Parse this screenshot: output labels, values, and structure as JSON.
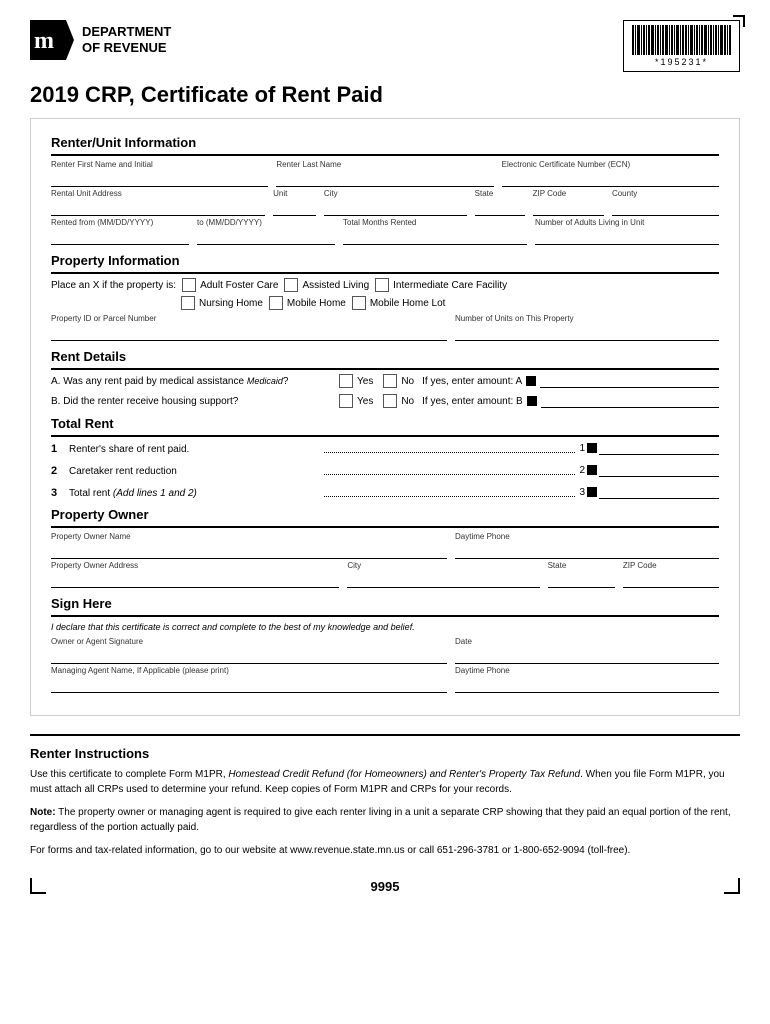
{
  "header": {
    "logo_dept_line1": "DEPARTMENT",
    "logo_dept_line2": "OF REVENUE",
    "form_title": "2019 CRP, Certificate of Rent Paid",
    "barcode_number": "*195231*"
  },
  "renter_info": {
    "section_title": "Renter/Unit Information",
    "field_first_name": "Renter First Name and Initial",
    "field_last_name": "Renter Last Name",
    "field_ecn": "Electronic Certificate Number (ECN)",
    "field_rental_address": "Rental Unit Address",
    "field_unit": "Unit",
    "field_city": "City",
    "field_state": "State",
    "field_zip": "ZIP Code",
    "field_county": "County",
    "field_rented_from": "Rented from (MM/DD/YYYY)",
    "field_rented_to": "to (MM/DD/YYYY)",
    "field_total_months": "Total Months Rented",
    "field_adults": "Number of Adults Living in Unit"
  },
  "property_info": {
    "section_title": "Property Information",
    "place_x_label": "Place an X if the property is:",
    "checkbox1": "Adult Foster Care",
    "checkbox2": "Assisted Living",
    "checkbox3": "Intermediate Care Facility",
    "checkbox4": "Nursing Home",
    "checkbox5": "Mobile Home",
    "checkbox6": "Mobile Home Lot",
    "field_property_id": "Property ID or Parcel Number",
    "field_num_units": "Number of Units on This Property"
  },
  "rent_details": {
    "section_title": "Rent Details",
    "row_a_label": "A. Was any rent paid by medical assistance (Medicaid)?",
    "row_a_medicaid": "Medicaid",
    "row_b_label": "B. Did the renter receive housing support?",
    "yes_label": "Yes",
    "no_label": "No",
    "if_yes_label_a": "If yes, enter amount:  A",
    "if_yes_label_b": "If yes, enter amount:  B"
  },
  "total_rent": {
    "section_title": "Total Rent",
    "row1_num": "1",
    "row1_label": "Renter's share of rent paid.",
    "row1_num_label": "1",
    "row2_num": "2",
    "row2_label": "Caretaker rent reduction",
    "row2_num_label": "2",
    "row3_num": "3",
    "row3_label": "Total rent (Add lines 1 and 2)",
    "row3_num_label": "3"
  },
  "property_owner": {
    "section_title": "Property Owner",
    "field_owner_name": "Property Owner Name",
    "field_daytime_phone": "Daytime Phone",
    "field_owner_address": "Property Owner Address",
    "field_city": "City",
    "field_state": "State",
    "field_zip": "ZIP Code"
  },
  "sign_here": {
    "section_title": "Sign Here",
    "declaration_text": "I declare that this certificate is correct and complete to the best of my knowledge and belief.",
    "field_signature": "Owner or Agent Signature",
    "field_date": "Date",
    "field_managing_agent": "Managing Agent Name, If Applicable (please print)",
    "field_daytime_phone": "Daytime Phone"
  },
  "instructions": {
    "section_title": "Renter Instructions",
    "paragraph1": "Use this certificate to complete Form M1PR, Homestead Credit Refund (for Homeowners) and Renter's Property Tax Refund. When you file Form M1PR, you must attach all CRPs used to determine your refund. Keep copies of Form M1PR and CRPs for your records.",
    "paragraph1_italic": "Homestead Credit Refund (for Homeowners) and Renter's Property Tax Refund",
    "note_label": "Note:",
    "note_text": "The property owner or managing agent is required to give each renter living in a unit a separate CRP showing that they paid an equal portion of the rent, regardless of the portion actually paid.",
    "contact_text": "For forms and tax-related information, go to our website at www.revenue.state.mn.us or call 651-296-3781 or 1-800-652-9094 (toll-free)."
  },
  "footer": {
    "page_number": "9995"
  }
}
